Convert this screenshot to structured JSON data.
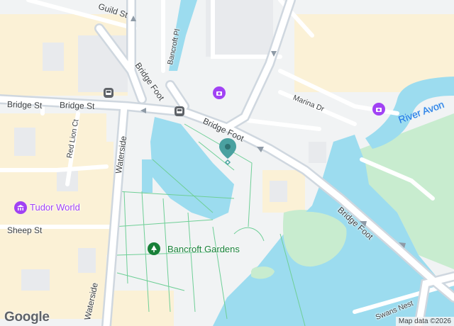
{
  "map": {
    "streets": {
      "guild_st": "Guild St",
      "bridge_st_1": "Bridge St",
      "bridge_st_2": "Bridge St",
      "bridge_foot_1": "Bridge Foot",
      "bridge_foot_2": "Bridge Foot",
      "bridge_foot_3": "Bridge Foot",
      "bancroft_pl": "Bancroft Pl",
      "marina_dr": "Marina Dr",
      "red_lion_ct": "Red Lion Ct",
      "waterside_1": "Waterside",
      "waterside_2": "Waterside",
      "sheep_st": "Sheep St",
      "swans_nest": "Swans Nest"
    },
    "pois": {
      "tudor_world": "Tudor World",
      "bancroft_gardens": "Bancroft Gardens"
    },
    "water": {
      "river_avon": "River Avon"
    },
    "icons": [
      "bus-stop-icon",
      "museum-icon",
      "museum-icon",
      "museum-icon",
      "park-icon",
      "location-pin-icon"
    ],
    "colors": {
      "water": "#9cdcef",
      "park": "#c8eccf",
      "road": "#ffffff",
      "major_road": "#c6d0da",
      "building": "#fbf1d6",
      "poi_purple": "#a142f4",
      "poi_green": "#188038",
      "pin": "#4aa1a0"
    },
    "google_logo": "Google",
    "attribution": "Map data ©2026"
  }
}
